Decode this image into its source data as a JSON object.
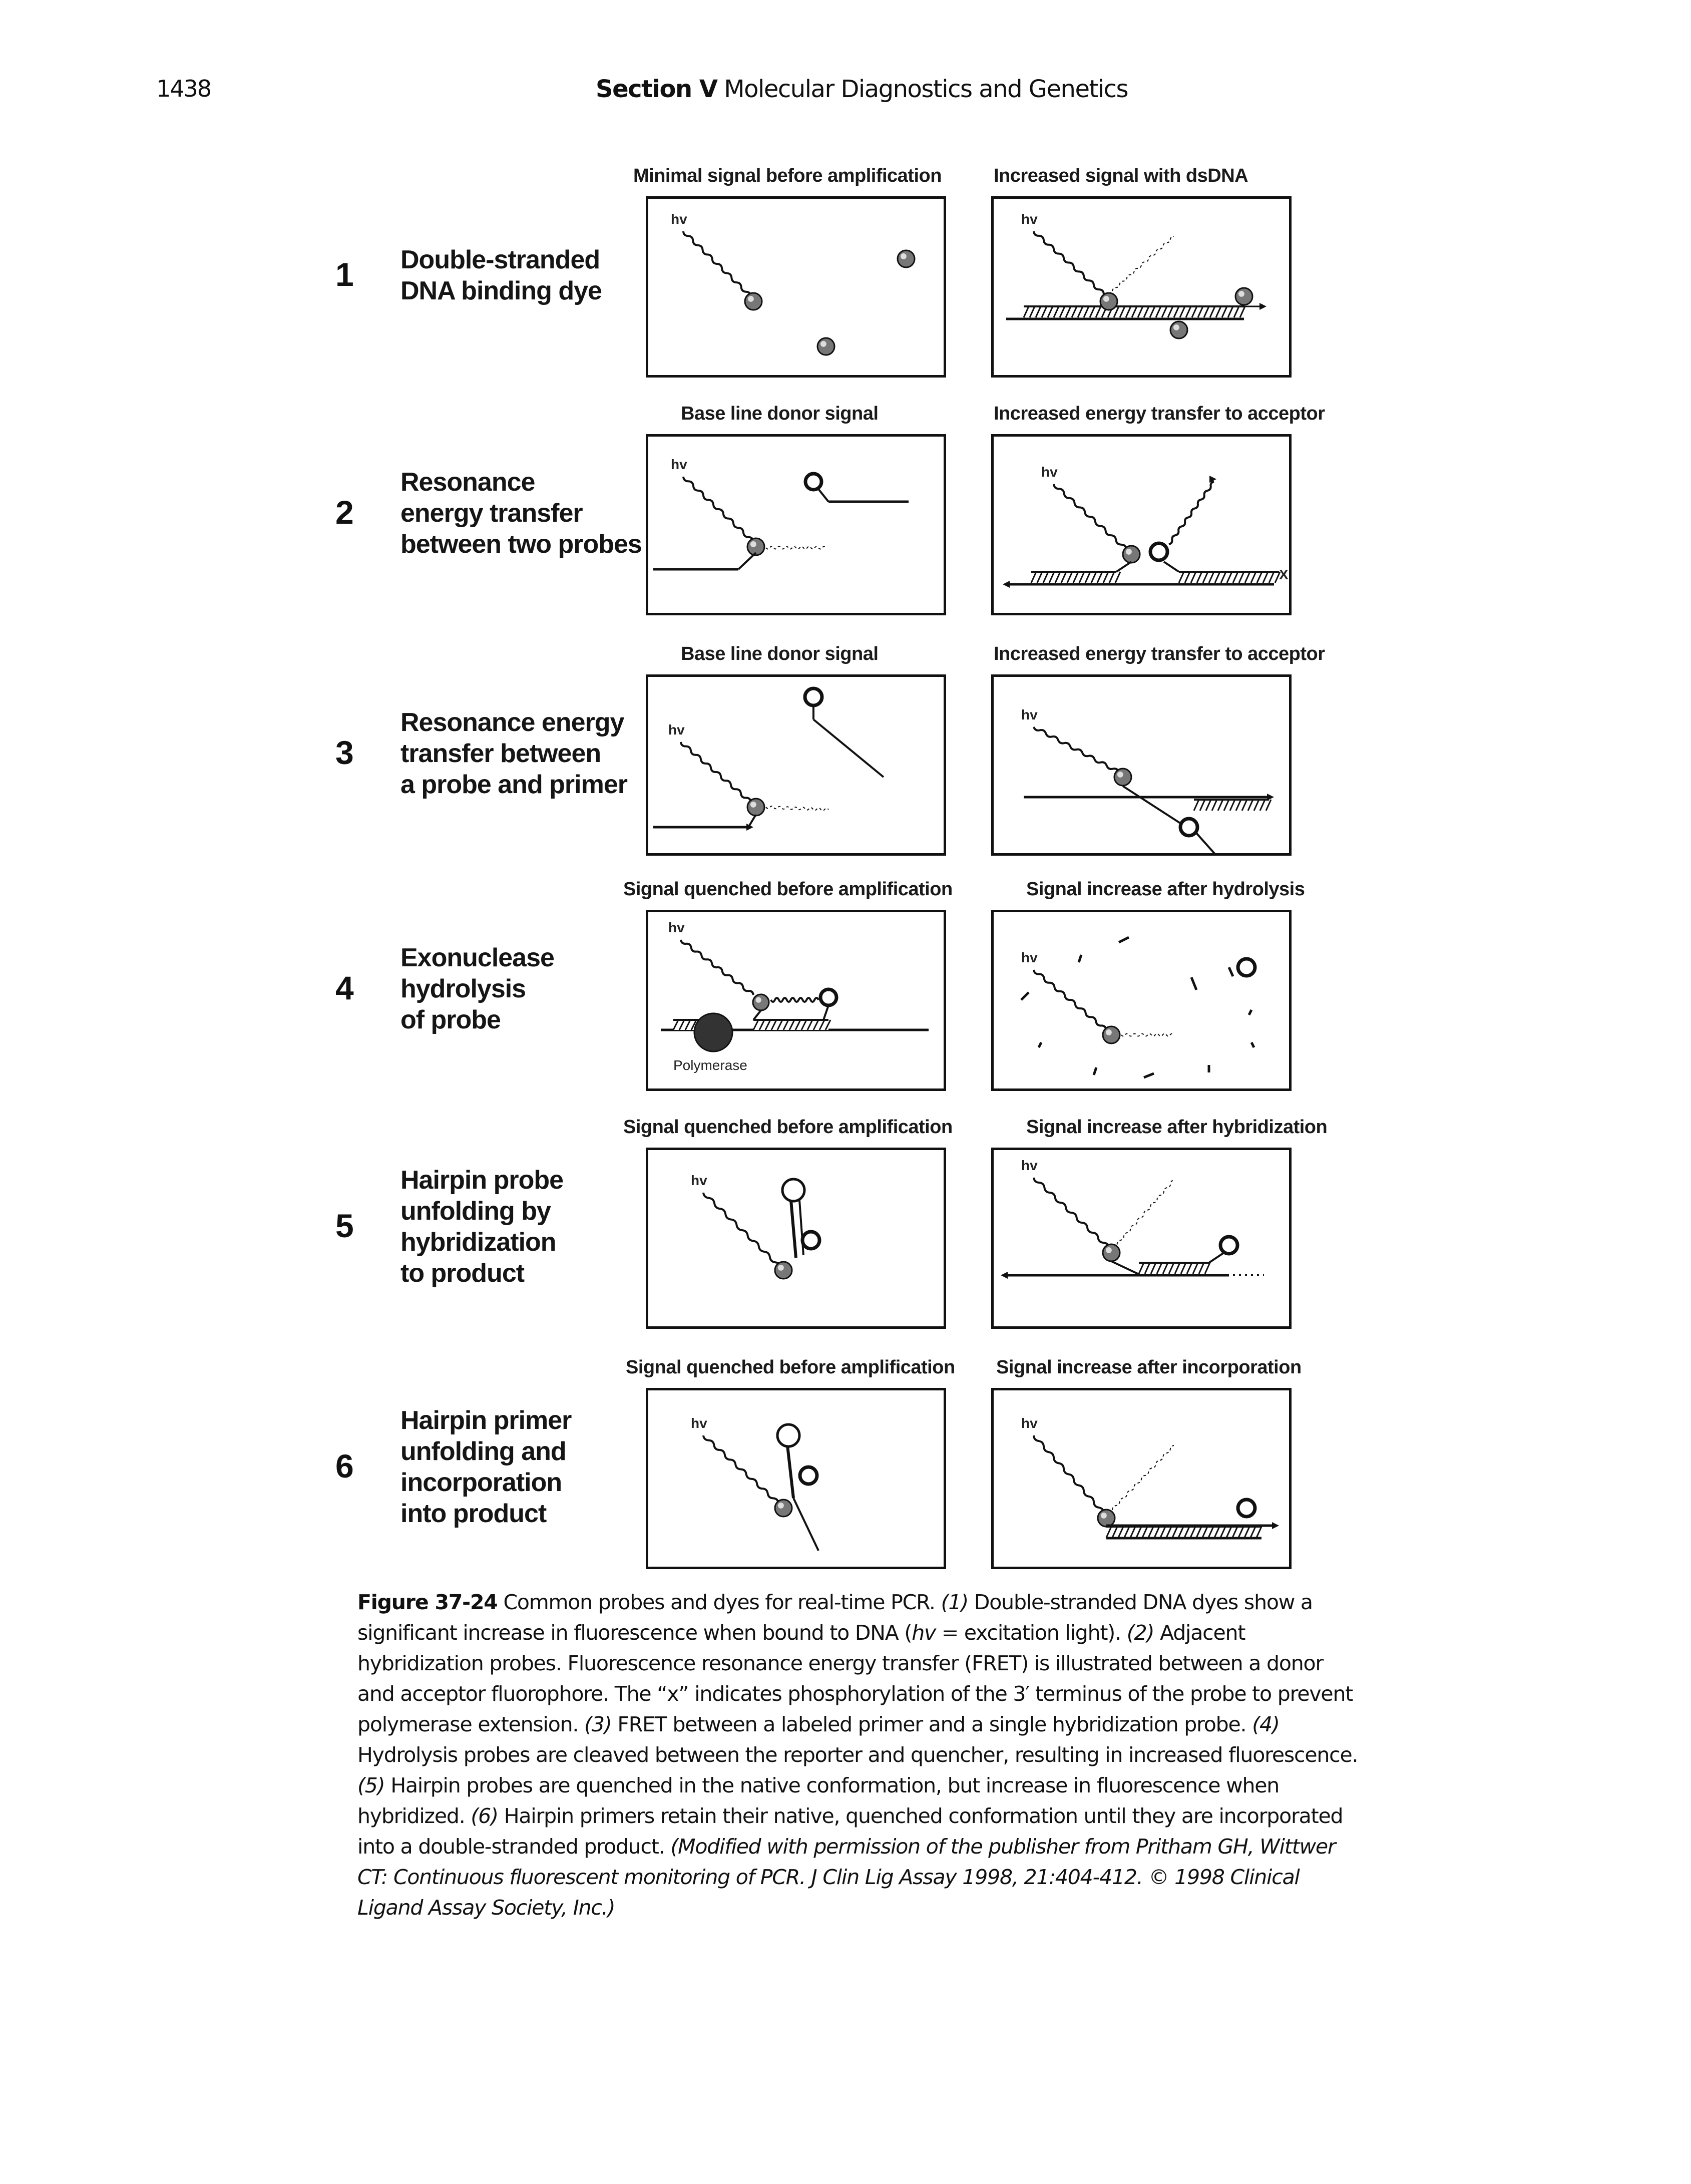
{
  "header": {
    "page_number": "1438",
    "section_label": "Section V",
    "section_title": "Molecular Diagnostics and Genetics"
  },
  "figure": {
    "hv_label": "hv",
    "polymerase_label": "Polymerase",
    "x_mark": "X",
    "rows": [
      {
        "number": "1",
        "label_lines": [
          "Double-stranded",
          "DNA binding dye"
        ],
        "left_caption": "Minimal signal before amplification",
        "right_caption": "Increased signal with dsDNA"
      },
      {
        "number": "2",
        "label_lines": [
          "Resonance",
          "energy transfer",
          "between two probes"
        ],
        "left_caption": "Base line donor signal",
        "right_caption": "Increased energy transfer to acceptor"
      },
      {
        "number": "3",
        "label_lines": [
          "Resonance energy",
          "transfer between",
          "a probe and primer"
        ],
        "left_caption": "Base line donor signal",
        "right_caption": "Increased energy transfer to acceptor"
      },
      {
        "number": "4",
        "label_lines": [
          "Exonuclease",
          "hydrolysis",
          "of probe"
        ],
        "left_caption": "Signal quenched before amplification",
        "right_caption": "Signal increase after hydrolysis"
      },
      {
        "number": "5",
        "label_lines": [
          "Hairpin probe",
          "unfolding by",
          "hybridization",
          "to product"
        ],
        "left_caption": "Signal quenched before amplification",
        "right_caption": "Signal increase after hybridization"
      },
      {
        "number": "6",
        "label_lines": [
          "Hairpin primer",
          "unfolding and",
          "incorporation",
          "into product"
        ],
        "left_caption": "Signal quenched before amplification",
        "right_caption": "Signal increase after incorporation"
      }
    ]
  },
  "caption": {
    "figure_label": "Figure 37-24",
    "intro": "Common probes and dyes for real-time PCR.",
    "items": [
      {
        "num": "(1)",
        "text": "Double-stranded DNA dyes show a significant increase in fluorescence when bound to DNA ("
      },
      {
        "num": "(2)",
        "text": "Adjacent hybridization probes. Fluorescence resonance energy transfer (FRET) is illustrated between a donor and acceptor fluorophore. The “x” indicates phosphorylation of the 3′ terminus of the probe to prevent polymerase extension."
      },
      {
        "num": "(3)",
        "text": "FRET between a labeled primer and a single hybridization probe."
      },
      {
        "num": "(4)",
        "text": "Hydrolysis probes are cleaved between the reporter and quencher, resulting in increased fluorescence."
      },
      {
        "num": "(5)",
        "text": "Hairpin probes are quenched in the native conformation, but increase in fluorescence when hybridized."
      },
      {
        "num": "(6)",
        "text": "Hairpin primers retain their native, quenched conformation until they are incorporated into a double-stranded product."
      }
    ],
    "hv_term": "hv",
    "hv_definition": " = excitation light).",
    "credit": "(Modified with permission of the publisher from Pritham GH, Wittwer CT: Continuous fluorescent monitoring of PCR. J Clin Lig Assay 1998, 21:404-412. © 1998 Clinical Ligand Assay Society, Inc.)"
  }
}
